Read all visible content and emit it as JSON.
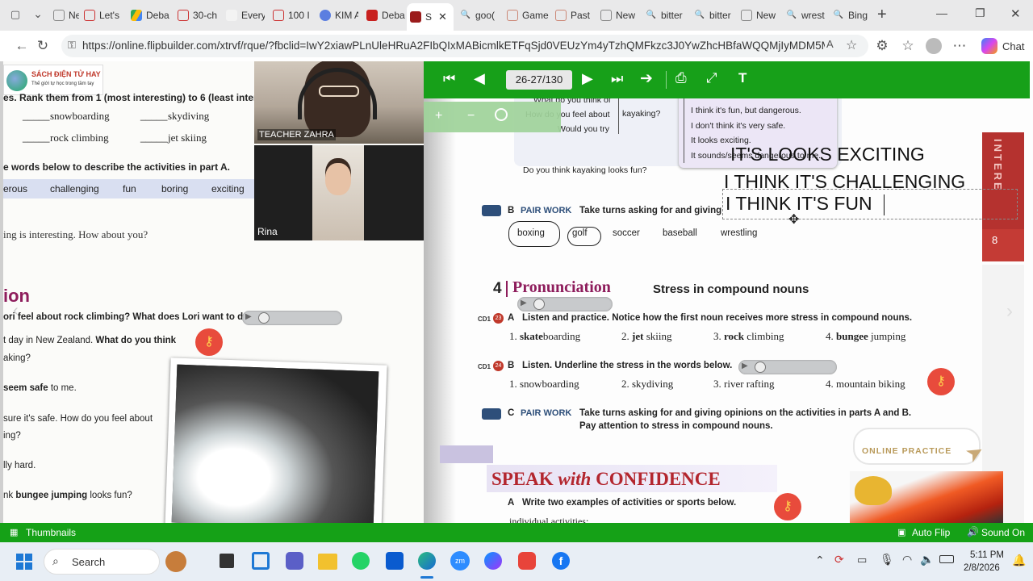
{
  "browser": {
    "tabs": [
      "New",
      "Let's",
      "Deba",
      "30-ch",
      "Every",
      "100 I",
      "KIM A",
      "Deba",
      "S",
      "goo(",
      "Game",
      "Past",
      "New",
      "bitter",
      "bitter",
      "New",
      "wrest",
      "Bing"
    ],
    "url": "https://online.flipbuilder.com/xtrvf/rque/?fbclid=IwY2xiawPLnUleHRuA2FIbQIxMABicmlkETFqSjd0VEUzYm4yTzhQMFkzc3J0YwZhcHBfaWQQMjIyMDM5MTc4...",
    "chat_label": "Chat"
  },
  "video": {
    "teacher_name": "TEACHER ZAHRA",
    "student_name": "Rina"
  },
  "logo": {
    "title": "SÁCH ĐIỆN TỬ HAY",
    "subtitle": "Thế giới tự học trong tầm tay"
  },
  "toolbar": {
    "page_indicator": "26-27/130"
  },
  "left_page": {
    "line1": "es. Rank them from 1 (most interesting) to 6 (least intere",
    "items_row1": [
      "snowboarding",
      "skydiving"
    ],
    "items_row2": [
      "rock climbing",
      "jet skiing"
    ],
    "blank": "_____",
    "instruction": "e words below to describe the activities in part A.",
    "words": [
      "erous",
      "challenging",
      "fun",
      "boring",
      "exciting"
    ],
    "sample": "ing is interesting. How about you?",
    "section": "ion",
    "q1": "ori feel about rock climbing? What does Lori want to do?",
    "d1a": "t day in New Zealand. ",
    "d1b": "What do you think",
    "d2": "aking?",
    "d3a": "seem safe",
    "d3b": " to me.",
    "d4": "sure it's safe. How do you feel about",
    "d5": "ing?",
    "d6": "lly hard.",
    "d7a": "nk ",
    "d7b": "bungee jumping",
    "d7c": " looks fun?"
  },
  "right_page": {
    "conv_left": [
      "What do you think of",
      "How do you feel about",
      "Would you try"
    ],
    "conv_mid": "kayaking?",
    "conv_right": [
      "I think it's fun, but dangerous.",
      "I don't think it's very safe.",
      "It looks exciting.",
      "It sounds/seems dangerous to me."
    ],
    "conv_bottom": "Do you think kayaking looks fun?",
    "overlay": [
      "IT'S LOOKS EXCITING",
      "I THINK IT'S CHALLENGING",
      "I THINK IT'S FUN"
    ],
    "pairB": {
      "letter": "B",
      "tag": "PAIR WORK",
      "text": "Take turns asking for and giving"
    },
    "sports": [
      "boxing",
      "golf",
      "soccer",
      "baseball",
      "wrestling"
    ],
    "side_tab": "INTERE",
    "side_num": "8",
    "pron_num": "4",
    "pron_title": "Pronunciation",
    "pron_sub": "Stress in compound nouns",
    "A": {
      "cd": "CD1",
      "track": "23",
      "letter": "A",
      "text": "Listen and practice. Notice how the first noun receives more stress in compound nouns.",
      "items": [
        {
          "n": "1.",
          "b": "skate",
          "r": "boarding"
        },
        {
          "n": "2.",
          "b": "jet",
          "r": " skiing"
        },
        {
          "n": "3.",
          "b": "rock",
          "r": " climbing"
        },
        {
          "n": "4.",
          "b": "bungee",
          "r": " jumping"
        }
      ]
    },
    "B": {
      "cd": "CD1",
      "track": "24",
      "letter": "B",
      "text": "Listen. Underline the stress in the words below.",
      "items": [
        "1. snowboarding",
        "2. skydiving",
        "3. river rafting",
        "4. mountain biking"
      ]
    },
    "C": {
      "letter": "C",
      "tag": "PAIR WORK",
      "text1": "Take turns asking for and giving opinions on the activities in parts A and B.",
      "text2": "Pay attention to stress in compound nouns."
    },
    "online": "ONLINE PRACTICE",
    "speak": {
      "a": "SPEAK",
      "b": "with",
      "c": "CONFIDENCE"
    },
    "speakA": {
      "letter": "A",
      "text": "Write two examples of activities or sports below."
    },
    "indiv": "individual activities:"
  },
  "bottom": {
    "thumbnails": "Thumbnails",
    "autoflip": "Auto Flip",
    "sound": "Sound On"
  },
  "taskbar": {
    "search": "Search",
    "time": "5:11 PM",
    "date": "2/8/2026"
  },
  "colors": {
    "green": "#17a019",
    "pron": "#8e1d5c",
    "speak_red": "#b3262e"
  }
}
